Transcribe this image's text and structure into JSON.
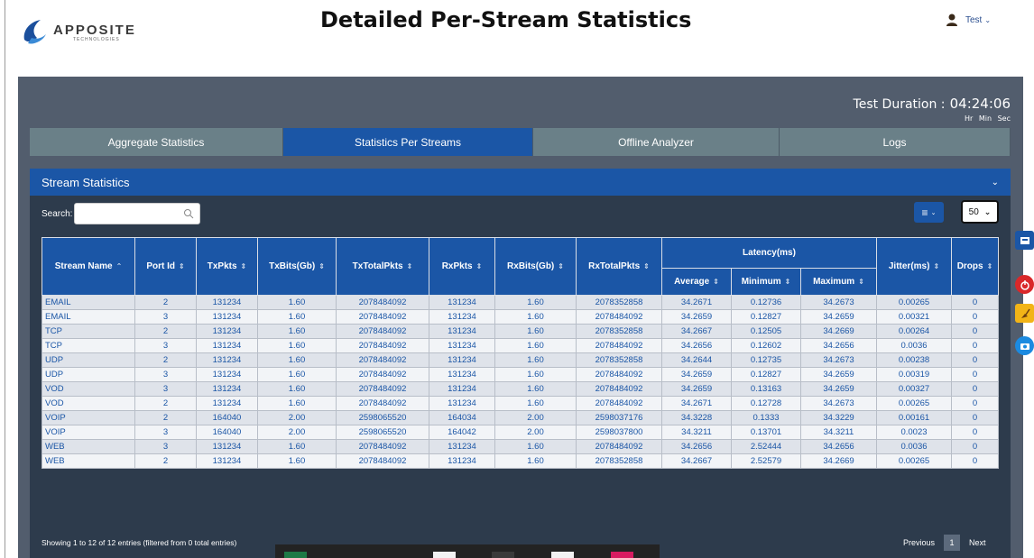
{
  "header": {
    "brand": "APPOSITE",
    "brand_sub": "TECHNOLOGIES",
    "page_title": "Detailed Per-Stream Statistics",
    "user_name": "Test"
  },
  "duration": {
    "label": "Test Duration :",
    "value": "04:24:06",
    "units": "Hr  Min  Sec"
  },
  "tabs": [
    {
      "label": "Aggregate Statistics",
      "active": false
    },
    {
      "label": "Statistics Per Streams",
      "active": true
    },
    {
      "label": "Offline Analyzer",
      "active": false
    },
    {
      "label": "Logs",
      "active": false
    }
  ],
  "stream_section": {
    "title": "Stream Statistics",
    "search_label": "Search:",
    "search_value": "",
    "page_size": "50",
    "columns": [
      "Stream Name",
      "Port Id",
      "TxPkts",
      "TxBits(Gb)",
      "TxTotalPkts",
      "RxPkts",
      "RxBits(Gb)",
      "RxTotalPkts",
      "Latency(ms)",
      "Jitter(ms)",
      "Drops"
    ],
    "latency_subcolumns": [
      "Average",
      "Minimum",
      "Maximum"
    ],
    "rows": [
      [
        "EMAIL",
        "2",
        "131234",
        "1.60",
        "2078484092",
        "131234",
        "1.60",
        "2078352858",
        "34.2671",
        "0.12736",
        "34.2673",
        "0.00265",
        "0"
      ],
      [
        "EMAIL",
        "3",
        "131234",
        "1.60",
        "2078484092",
        "131234",
        "1.60",
        "2078484092",
        "34.2659",
        "0.12827",
        "34.2659",
        "0.00321",
        "0"
      ],
      [
        "TCP",
        "2",
        "131234",
        "1.60",
        "2078484092",
        "131234",
        "1.60",
        "2078352858",
        "34.2667",
        "0.12505",
        "34.2669",
        "0.00264",
        "0"
      ],
      [
        "TCP",
        "3",
        "131234",
        "1.60",
        "2078484092",
        "131234",
        "1.60",
        "2078484092",
        "34.2656",
        "0.12602",
        "34.2656",
        "0.0036",
        "0"
      ],
      [
        "UDP",
        "2",
        "131234",
        "1.60",
        "2078484092",
        "131234",
        "1.60",
        "2078352858",
        "34.2644",
        "0.12735",
        "34.2673",
        "0.00238",
        "0"
      ],
      [
        "UDP",
        "3",
        "131234",
        "1.60",
        "2078484092",
        "131234",
        "1.60",
        "2078484092",
        "34.2659",
        "0.12827",
        "34.2659",
        "0.00319",
        "0"
      ],
      [
        "VOD",
        "3",
        "131234",
        "1.60",
        "2078484092",
        "131234",
        "1.60",
        "2078484092",
        "34.2659",
        "0.13163",
        "34.2659",
        "0.00327",
        "0"
      ],
      [
        "VOD",
        "2",
        "131234",
        "1.60",
        "2078484092",
        "131234",
        "1.60",
        "2078484092",
        "34.2671",
        "0.12728",
        "34.2673",
        "0.00265",
        "0"
      ],
      [
        "VOIP",
        "2",
        "164040",
        "2.00",
        "2598065520",
        "164034",
        "2.00",
        "2598037176",
        "34.3228",
        "0.1333",
        "34.3229",
        "0.00161",
        "0"
      ],
      [
        "VOIP",
        "3",
        "164040",
        "2.00",
        "2598065520",
        "164042",
        "2.00",
        "2598037800",
        "34.3211",
        "0.13701",
        "34.3211",
        "0.0023",
        "0"
      ],
      [
        "WEB",
        "3",
        "131234",
        "1.60",
        "2078484092",
        "131234",
        "1.60",
        "2078484092",
        "34.2656",
        "2.52444",
        "34.2656",
        "0.0036",
        "0"
      ],
      [
        "WEB",
        "2",
        "131234",
        "1.60",
        "2078484092",
        "131234",
        "1.60",
        "2078352858",
        "34.2667",
        "2.52579",
        "34.2669",
        "0.00265",
        "0"
      ]
    ],
    "info": "Showing 1 to 12 of 12 entries (filtered from 0 total entries)",
    "pager": {
      "previous": "Previous",
      "current": "1",
      "next": "Next"
    }
  },
  "colors": {
    "accent": "#1b56a6",
    "panel": "#525d6d",
    "table_bg": "#2d3b4c"
  }
}
